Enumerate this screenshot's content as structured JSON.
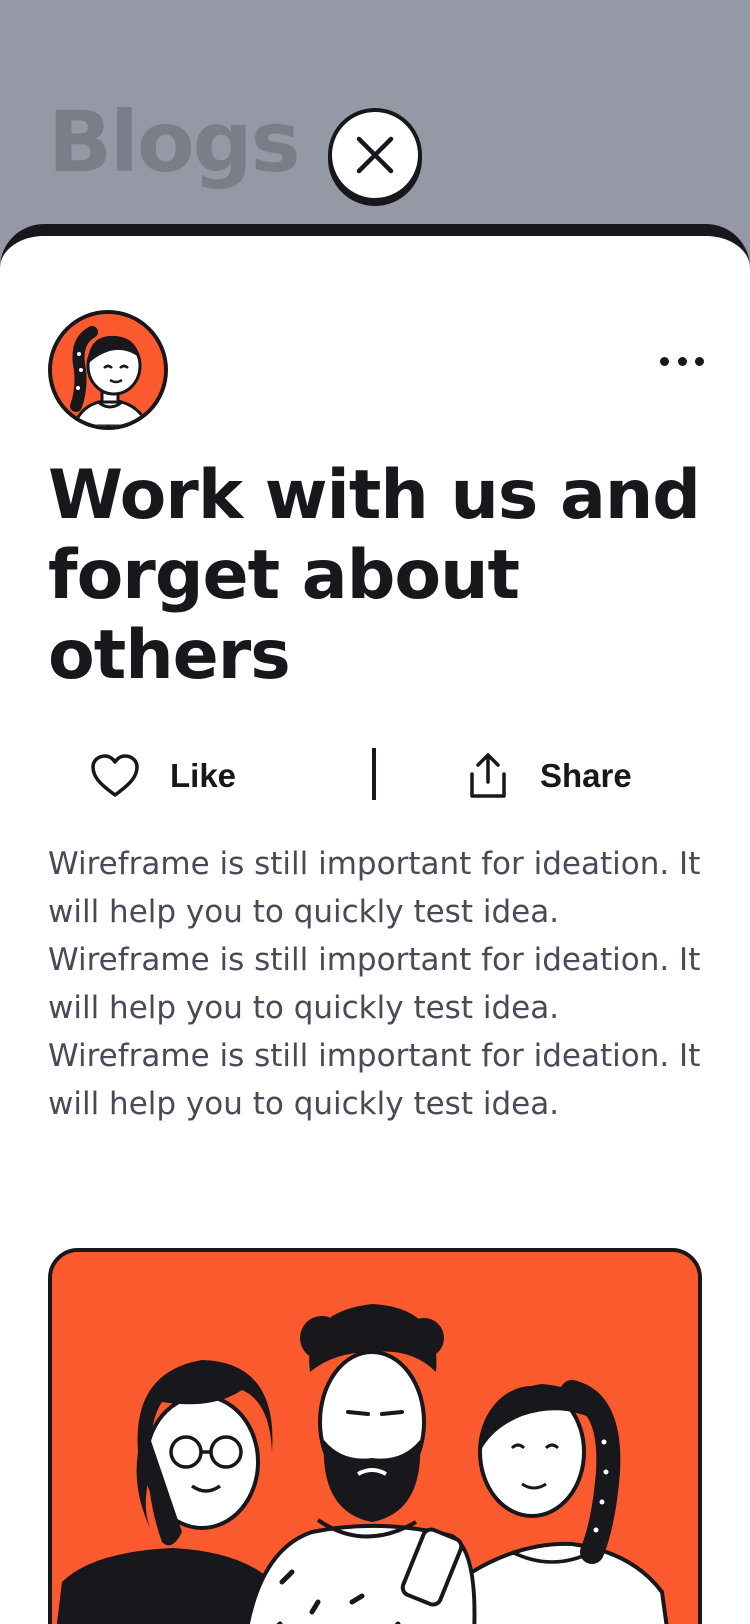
{
  "page": {
    "heading": "Blogs"
  },
  "post": {
    "title": "Work with us and forget about others",
    "body": "Wireframe is still important for ideation. It will help you to quickly test idea. Wireframe is still important for ideation. It will help you to quickly test idea. Wireframe is still important for ideation. It will help you to quickly test idea."
  },
  "actions": {
    "like_label": "Like",
    "share_label": "Share"
  },
  "icons": {
    "close": "close-icon",
    "more": "more-horizontal-icon",
    "like": "heart-icon",
    "share": "share-upload-icon"
  },
  "colors": {
    "accent": "#fa5a2d",
    "ink": "#17171c",
    "backdrop": "#9599a6",
    "body_text": "#484a57"
  }
}
